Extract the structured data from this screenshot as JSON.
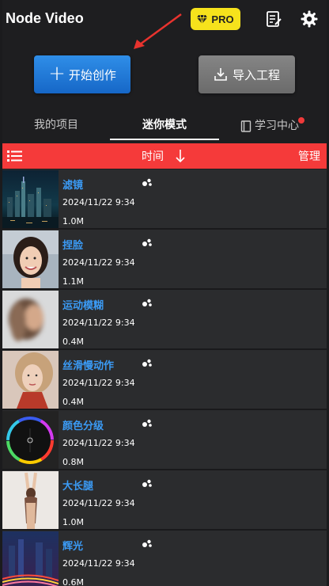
{
  "header": {
    "app_title": "Node Video",
    "pro_label": "PRO"
  },
  "actions": {
    "create_label": "开始创作",
    "import_label": "导入工程"
  },
  "tabs": [
    {
      "label": "我的项目",
      "active": false
    },
    {
      "label": "迷你模式",
      "active": true
    },
    {
      "label": "学习中心",
      "active": false,
      "has_notification_dot": true
    }
  ],
  "toolbar": {
    "sort_label": "时间",
    "manage_label": "管理"
  },
  "items": [
    {
      "title": "滤镜",
      "date": "2024/11/22 9:34",
      "size": "1.0M",
      "thumb": "city-night"
    },
    {
      "title": "捏脸",
      "date": "2024/11/22 9:34",
      "size": "1.1M",
      "thumb": "portrait-smile"
    },
    {
      "title": "运动模糊",
      "date": "2024/11/22 9:34",
      "size": "0.4M",
      "thumb": "motion-blur"
    },
    {
      "title": "丝滑慢动作",
      "date": "2024/11/22 9:34",
      "size": "0.4M",
      "thumb": "portrait-hair"
    },
    {
      "title": "颜色分级",
      "date": "2024/11/22 9:34",
      "size": "0.8M",
      "thumb": "color-wheel"
    },
    {
      "title": "大长腿",
      "date": "2024/11/22 9:34",
      "size": "1.0M",
      "thumb": "stretch"
    },
    {
      "title": "辉光",
      "date": "2024/11/22 9:34",
      "size": "0.6M",
      "thumb": "light-trails"
    }
  ],
  "colors": {
    "accent_blue": "#2f8ee8",
    "toolbar_red": "#f53a3a",
    "pro_yellow": "#f6e21c",
    "title_blue": "#3b9bf5"
  }
}
